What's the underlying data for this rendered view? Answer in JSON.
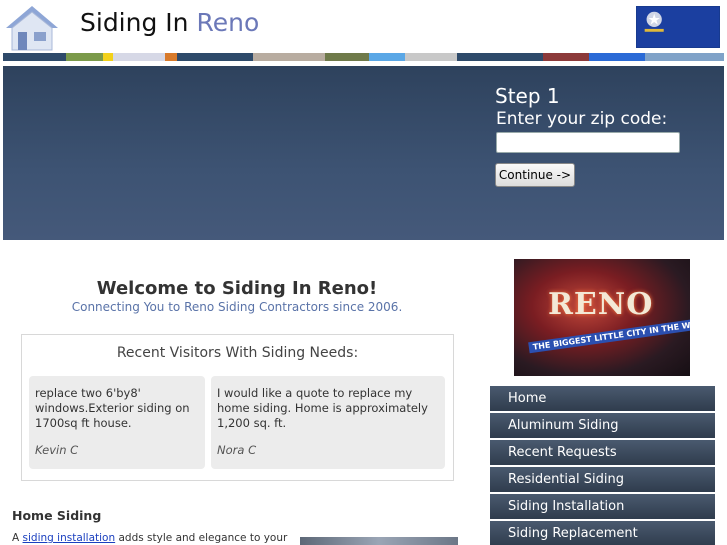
{
  "header": {
    "title_main": "Siding In",
    "title_accent": "Reno",
    "strip_colors": [
      "#2e4a6a",
      "#7b9a4a",
      "#f2d11a",
      "#d6d8e6",
      "#d87a2a",
      "#2e4a6a",
      "#b8aca0",
      "#6f7a4a",
      "#5aa7e6",
      "#c8c8c8",
      "#2e4a6a",
      "#8c3a3a",
      "#2a6ad6",
      "#7fa2c8"
    ]
  },
  "hero": {
    "step": "Step 1",
    "zip_label": "Enter your zip code:",
    "zip_value": "",
    "continue_label": "Continue ->"
  },
  "main": {
    "welcome": "Welcome to Siding In Reno!",
    "tagline": "Connecting You to Reno Siding Contractors since 2006.",
    "visitors_title": "Recent Visitors With Siding Needs:",
    "visitors": [
      {
        "text": "replace two 6'by8' windows.Exterior siding on 1700sq ft house.",
        "name": "Kevin C"
      },
      {
        "text": "I would like a quote to replace my home siding. Home is approximately 1,200 sq. ft.",
        "name": "Nora C"
      }
    ],
    "section_heading": "Home Siding",
    "para_prefix": "A ",
    "para_link": "siding installation",
    "para_suffix": " adds style and elegance to your"
  },
  "sidebar": {
    "image_text": "RENO",
    "image_subtext": "THE BIGGEST LITTLE CITY IN THE WORLD",
    "nav": [
      "Home",
      "Aluminum Siding",
      "Recent Requests",
      "Residential Siding",
      "Siding Installation",
      "Siding Replacement"
    ]
  }
}
